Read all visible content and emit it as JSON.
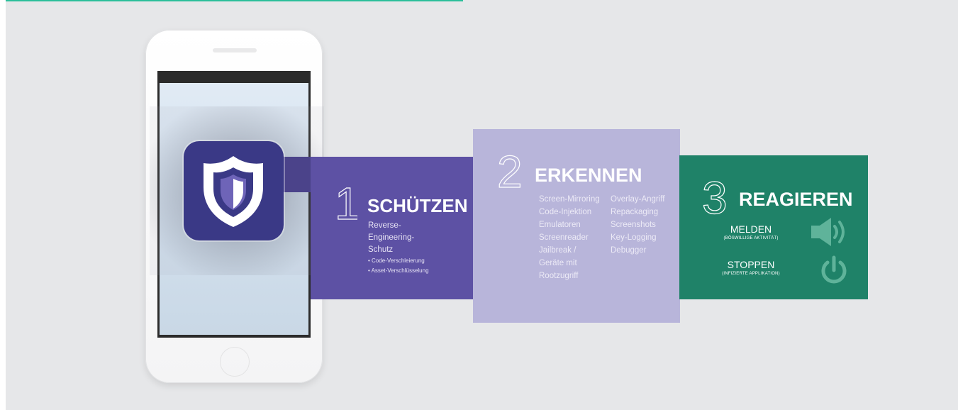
{
  "colors": {
    "background": "#e6e7e9",
    "accent_line": "#2bbf9a",
    "protect_panel": "#5d51a4",
    "detect_panel": "#b8b5da",
    "react_panel": "#1f8268",
    "app_icon": "#3a3986"
  },
  "app": {
    "icon": "shield-icon"
  },
  "steps": {
    "protect": {
      "number": "1",
      "title": "SCHÜTZEN",
      "lines": [
        "Reverse-",
        "Engineering-",
        "Schutz"
      ],
      "bullets": [
        "• Code-Verschleierung",
        "• Asset-Verschlüsselung"
      ]
    },
    "detect": {
      "number": "2",
      "title": "ERKENNEN",
      "col1": [
        "Screen-Mirroring",
        "Code-Injektion",
        "Emulatoren",
        "Screenreader",
        "Jailbreak /",
        "Geräte mit",
        "Rootzugriff"
      ],
      "col2": [
        "Overlay-Angriff",
        "Repackaging",
        "Screenshots",
        "Key-Logging",
        "Debugger"
      ]
    },
    "react": {
      "number": "3",
      "title": "REAGIEREN",
      "report": {
        "label": "MELDEN",
        "sub": "(BÖSWILLIGE AKTIVITÄT)",
        "icon": "speaker-icon"
      },
      "stop": {
        "label": "STOPPEN",
        "sub": "(INFIZIERTE APPLIKATION)",
        "icon": "power-icon"
      }
    }
  }
}
